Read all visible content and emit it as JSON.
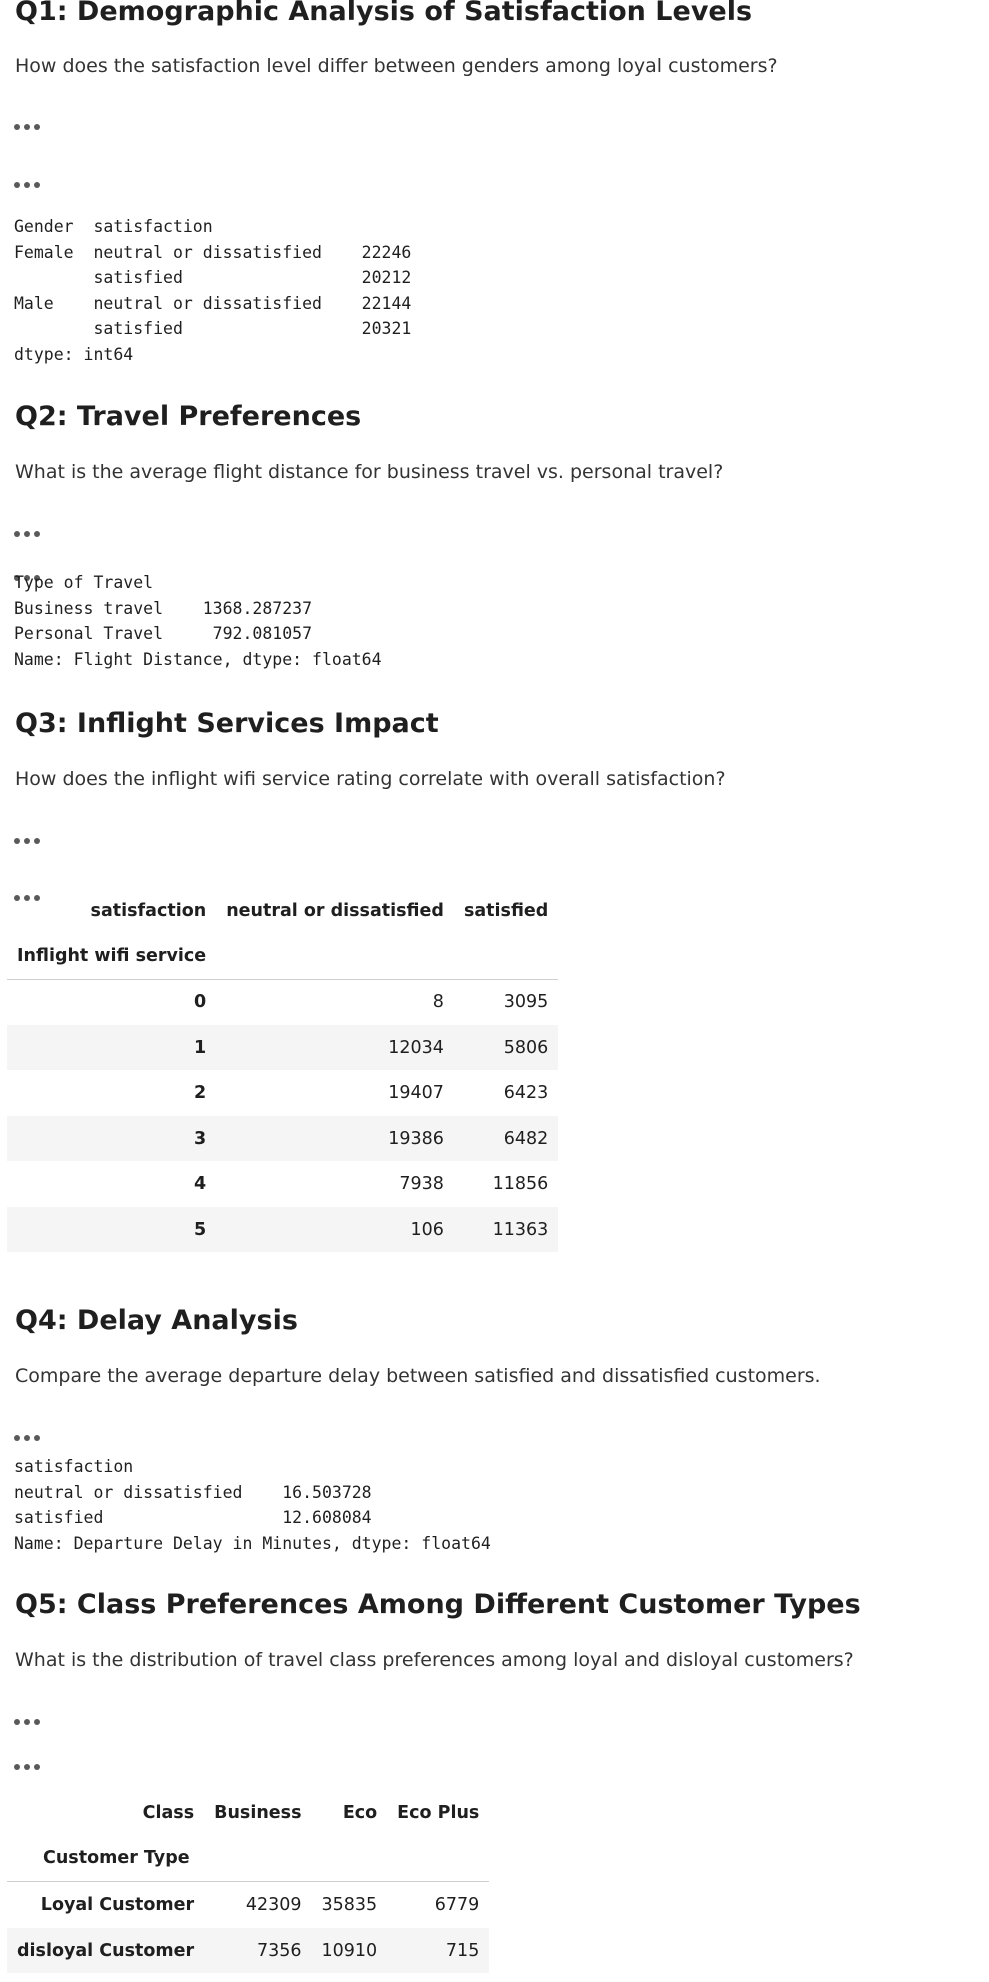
{
  "q1": {
    "title": "Q1: Demographic Analysis of Satisfaction Levels",
    "desc": "How does the satisfaction level differ between genders among loyal customers?",
    "output": "Gender  satisfaction           \nFemale  neutral or dissatisfied    22246\n        satisfied                  20212\nMale    neutral or dissatisfied    22144\n        satisfied                  20321\ndtype: int64"
  },
  "q2": {
    "title": "Q2: Travel Preferences",
    "desc": "What is the average flight distance for business travel vs. personal travel?",
    "output": "Type of Travel\nBusiness travel    1368.287237\nPersonal Travel     792.081057\nName: Flight Distance, dtype: float64"
  },
  "q3": {
    "title": "Q3: Inflight Services Impact",
    "desc": "How does the inflight wifi service rating correlate with overall satisfaction?",
    "table": {
      "col_axis": "satisfaction",
      "columns": [
        "neutral or dissatisfied",
        "satisfied"
      ],
      "index_name": "Inflight wifi service",
      "rows": [
        {
          "idx": "0",
          "vals": [
            "8",
            "3095"
          ]
        },
        {
          "idx": "1",
          "vals": [
            "12034",
            "5806"
          ]
        },
        {
          "idx": "2",
          "vals": [
            "19407",
            "6423"
          ]
        },
        {
          "idx": "3",
          "vals": [
            "19386",
            "6482"
          ]
        },
        {
          "idx": "4",
          "vals": [
            "7938",
            "11856"
          ]
        },
        {
          "idx": "5",
          "vals": [
            "106",
            "11363"
          ]
        }
      ]
    }
  },
  "q4": {
    "title": "Q4: Delay Analysis",
    "desc": "Compare the average departure delay between satisfied and dissatisfied customers.",
    "output": "satisfaction\nneutral or dissatisfied    16.503728\nsatisfied                  12.608084\nName: Departure Delay in Minutes, dtype: float64"
  },
  "q5": {
    "title": "Q5: Class Preferences Among Different Customer Types",
    "desc": "What is the distribution of travel class preferences among loyal and disloyal customers?",
    "table": {
      "col_axis": "Class",
      "columns": [
        "Business",
        "Eco",
        "Eco Plus"
      ],
      "index_name": "Customer Type",
      "rows": [
        {
          "idx": "Loyal Customer",
          "vals": [
            "42309",
            "35835",
            "6779"
          ]
        },
        {
          "idx": "disloyal Customer",
          "vals": [
            "7356",
            "10910",
            "715"
          ]
        }
      ]
    }
  },
  "icons": {
    "collapsed_cell": "ellipsis-icon"
  }
}
